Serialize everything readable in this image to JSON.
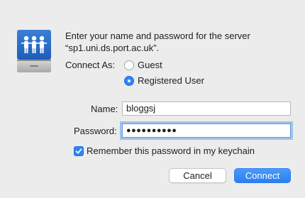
{
  "dialog": {
    "message": "Enter your name and password for the server “sp1.uni.ds.port.ac.uk”.",
    "connect_as_label": "Connect As:",
    "options": [
      {
        "label": "Guest",
        "selected": false
      },
      {
        "label": "Registered User",
        "selected": true
      }
    ],
    "name_label": "Name:",
    "name_value": "bloggsj",
    "password_label": "Password:",
    "password_value": "●●●●●●●●●●",
    "remember_label": "Remember this password in my keychain",
    "remember_checked": true,
    "cancel_label": "Cancel",
    "connect_label": "Connect"
  },
  "icons": {
    "server": "shared-server-icon",
    "check": "checkmark-icon"
  },
  "colors": {
    "accent": "#2f84f5",
    "background": "#ececec"
  }
}
